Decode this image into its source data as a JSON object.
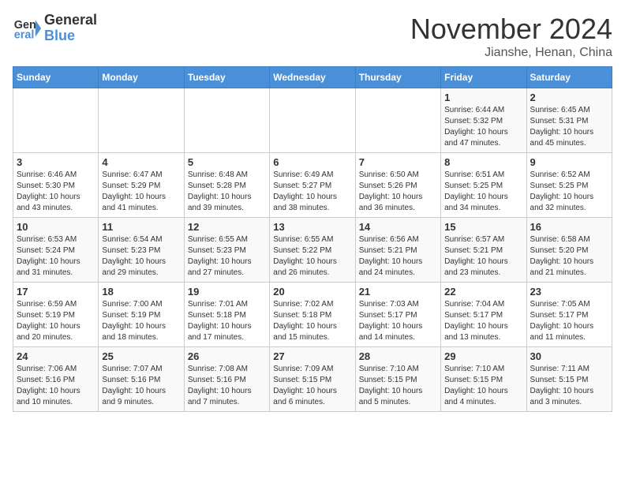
{
  "logo": {
    "line1": "General",
    "line2": "Blue"
  },
  "title": "November 2024",
  "subtitle": "Jianshe, Henan, China",
  "days_of_week": [
    "Sunday",
    "Monday",
    "Tuesday",
    "Wednesday",
    "Thursday",
    "Friday",
    "Saturday"
  ],
  "weeks": [
    [
      {
        "day": "",
        "info": ""
      },
      {
        "day": "",
        "info": ""
      },
      {
        "day": "",
        "info": ""
      },
      {
        "day": "",
        "info": ""
      },
      {
        "day": "",
        "info": ""
      },
      {
        "day": "1",
        "info": "Sunrise: 6:44 AM\nSunset: 5:32 PM\nDaylight: 10 hours\nand 47 minutes."
      },
      {
        "day": "2",
        "info": "Sunrise: 6:45 AM\nSunset: 5:31 PM\nDaylight: 10 hours\nand 45 minutes."
      }
    ],
    [
      {
        "day": "3",
        "info": "Sunrise: 6:46 AM\nSunset: 5:30 PM\nDaylight: 10 hours\nand 43 minutes."
      },
      {
        "day": "4",
        "info": "Sunrise: 6:47 AM\nSunset: 5:29 PM\nDaylight: 10 hours\nand 41 minutes."
      },
      {
        "day": "5",
        "info": "Sunrise: 6:48 AM\nSunset: 5:28 PM\nDaylight: 10 hours\nand 39 minutes."
      },
      {
        "day": "6",
        "info": "Sunrise: 6:49 AM\nSunset: 5:27 PM\nDaylight: 10 hours\nand 38 minutes."
      },
      {
        "day": "7",
        "info": "Sunrise: 6:50 AM\nSunset: 5:26 PM\nDaylight: 10 hours\nand 36 minutes."
      },
      {
        "day": "8",
        "info": "Sunrise: 6:51 AM\nSunset: 5:25 PM\nDaylight: 10 hours\nand 34 minutes."
      },
      {
        "day": "9",
        "info": "Sunrise: 6:52 AM\nSunset: 5:25 PM\nDaylight: 10 hours\nand 32 minutes."
      }
    ],
    [
      {
        "day": "10",
        "info": "Sunrise: 6:53 AM\nSunset: 5:24 PM\nDaylight: 10 hours\nand 31 minutes."
      },
      {
        "day": "11",
        "info": "Sunrise: 6:54 AM\nSunset: 5:23 PM\nDaylight: 10 hours\nand 29 minutes."
      },
      {
        "day": "12",
        "info": "Sunrise: 6:55 AM\nSunset: 5:23 PM\nDaylight: 10 hours\nand 27 minutes."
      },
      {
        "day": "13",
        "info": "Sunrise: 6:55 AM\nSunset: 5:22 PM\nDaylight: 10 hours\nand 26 minutes."
      },
      {
        "day": "14",
        "info": "Sunrise: 6:56 AM\nSunset: 5:21 PM\nDaylight: 10 hours\nand 24 minutes."
      },
      {
        "day": "15",
        "info": "Sunrise: 6:57 AM\nSunset: 5:21 PM\nDaylight: 10 hours\nand 23 minutes."
      },
      {
        "day": "16",
        "info": "Sunrise: 6:58 AM\nSunset: 5:20 PM\nDaylight: 10 hours\nand 21 minutes."
      }
    ],
    [
      {
        "day": "17",
        "info": "Sunrise: 6:59 AM\nSunset: 5:19 PM\nDaylight: 10 hours\nand 20 minutes."
      },
      {
        "day": "18",
        "info": "Sunrise: 7:00 AM\nSunset: 5:19 PM\nDaylight: 10 hours\nand 18 minutes."
      },
      {
        "day": "19",
        "info": "Sunrise: 7:01 AM\nSunset: 5:18 PM\nDaylight: 10 hours\nand 17 minutes."
      },
      {
        "day": "20",
        "info": "Sunrise: 7:02 AM\nSunset: 5:18 PM\nDaylight: 10 hours\nand 15 minutes."
      },
      {
        "day": "21",
        "info": "Sunrise: 7:03 AM\nSunset: 5:17 PM\nDaylight: 10 hours\nand 14 minutes."
      },
      {
        "day": "22",
        "info": "Sunrise: 7:04 AM\nSunset: 5:17 PM\nDaylight: 10 hours\nand 13 minutes."
      },
      {
        "day": "23",
        "info": "Sunrise: 7:05 AM\nSunset: 5:17 PM\nDaylight: 10 hours\nand 11 minutes."
      }
    ],
    [
      {
        "day": "24",
        "info": "Sunrise: 7:06 AM\nSunset: 5:16 PM\nDaylight: 10 hours\nand 10 minutes."
      },
      {
        "day": "25",
        "info": "Sunrise: 7:07 AM\nSunset: 5:16 PM\nDaylight: 10 hours\nand 9 minutes."
      },
      {
        "day": "26",
        "info": "Sunrise: 7:08 AM\nSunset: 5:16 PM\nDaylight: 10 hours\nand 7 minutes."
      },
      {
        "day": "27",
        "info": "Sunrise: 7:09 AM\nSunset: 5:15 PM\nDaylight: 10 hours\nand 6 minutes."
      },
      {
        "day": "28",
        "info": "Sunrise: 7:10 AM\nSunset: 5:15 PM\nDaylight: 10 hours\nand 5 minutes."
      },
      {
        "day": "29",
        "info": "Sunrise: 7:10 AM\nSunset: 5:15 PM\nDaylight: 10 hours\nand 4 minutes."
      },
      {
        "day": "30",
        "info": "Sunrise: 7:11 AM\nSunset: 5:15 PM\nDaylight: 10 hours\nand 3 minutes."
      }
    ]
  ]
}
